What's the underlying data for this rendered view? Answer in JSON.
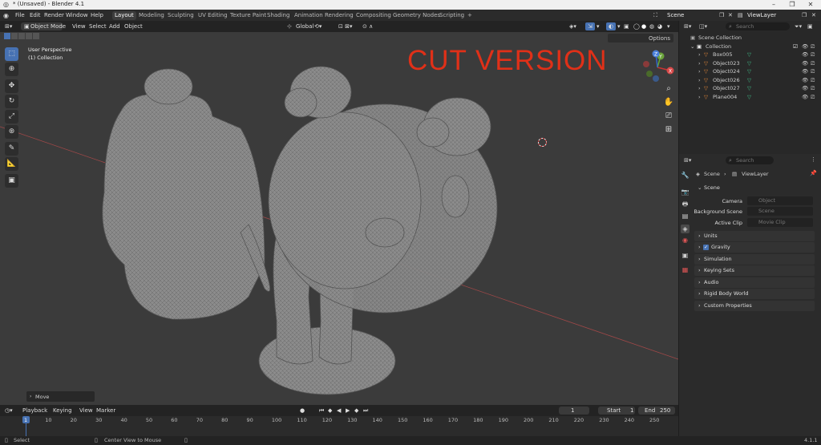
{
  "window": {
    "title": "* (Unsaved) - Blender 4.1",
    "minimize": "–",
    "maximize": "❐",
    "close": "✕"
  },
  "menus": [
    "File",
    "Edit",
    "Render",
    "Window",
    "Help"
  ],
  "workspace_tabs": [
    "Layout",
    "Modeling",
    "Sculpting",
    "UV Editing",
    "Texture Paint",
    "Shading",
    "Animation",
    "Rendering",
    "Compositing",
    "Geometry Nodes",
    "Scripting"
  ],
  "add_workspace": "+",
  "scene_selector": {
    "value": "Scene"
  },
  "viewlayer_selector": {
    "value": "ViewLayer"
  },
  "viewport_header": {
    "mode": "Object Mode",
    "menus": [
      "View",
      "Select",
      "Add",
      "Object"
    ],
    "orientation": "Global",
    "options": "Options"
  },
  "viewport": {
    "perspective": "User Perspective",
    "collection": "(1) Collection",
    "overlay_text": "CUT VERSION",
    "gizmo": {
      "x": "X",
      "y": "Y",
      "z": "Z"
    },
    "last_operator": "Move"
  },
  "outliner": {
    "search_placeholder": "Search",
    "scene_collection": "Scene Collection",
    "collection": "Collection",
    "objects": [
      "Box005",
      "Object023",
      "Object024",
      "Object026",
      "Object027",
      "Plane004"
    ]
  },
  "properties": {
    "search_placeholder": "Search",
    "breadcrumb": {
      "scene": "Scene",
      "viewlayer": "ViewLayer"
    },
    "scene_panel": "Scene",
    "fields": [
      {
        "label": "Camera",
        "placeholder": "Object"
      },
      {
        "label": "Background Scene",
        "placeholder": "Scene"
      },
      {
        "label": "Active Clip",
        "placeholder": "Movie Clip"
      }
    ],
    "panels": [
      "Units",
      "Gravity",
      "Simulation",
      "Keying Sets",
      "Audio",
      "Rigid Body World",
      "Custom Properties"
    ],
    "gravity_checked": true
  },
  "timeline": {
    "menus": [
      "Playback",
      "Keying",
      "View",
      "Marker"
    ],
    "current_frame": "1",
    "start_label": "Start",
    "start": "1",
    "end_label": "End",
    "end": "250",
    "ticks": [
      "1",
      "10",
      "20",
      "30",
      "40",
      "50",
      "60",
      "70",
      "80",
      "90",
      "100",
      "110",
      "120",
      "130",
      "140",
      "150",
      "160",
      "170",
      "180",
      "190",
      "200",
      "210",
      "220",
      "230",
      "240",
      "250"
    ]
  },
  "statusbar": {
    "select": "Select",
    "center_view": "Center View to Mouse",
    "version": "4.1.1"
  },
  "colors": {
    "accent": "#4772b3",
    "overlay_red": "#e03018",
    "viewport_bg": "#3b3b3b",
    "mesh": "#8a8a8a"
  }
}
